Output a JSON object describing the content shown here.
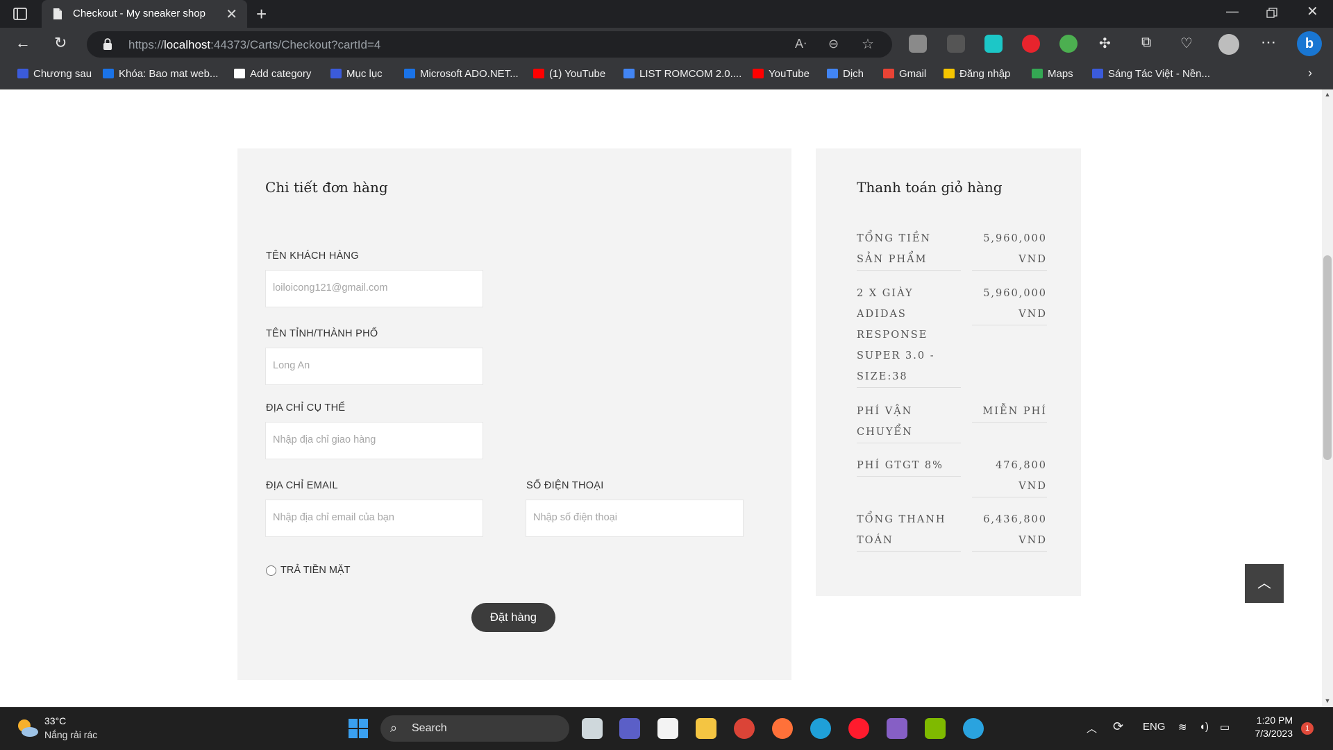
{
  "browser": {
    "tab_title": "Checkout - My sneaker shop",
    "url_prefix": "https://",
    "url_host": "localhost",
    "url_rest": ":44373/Carts/Checkout?cartId=4"
  },
  "bookmarks": [
    {
      "label": "Chương sau",
      "icon": "page-icon",
      "color": "#3b5bdb"
    },
    {
      "label": "Khóa: Bao mat web...",
      "icon": "t-icon",
      "color": "#1a73e8"
    },
    {
      "label": "Add category",
      "icon": "document-icon",
      "color": "#ffffff"
    },
    {
      "label": "Mục lục",
      "icon": "page-icon",
      "color": "#3b5bdb"
    },
    {
      "label": "Microsoft ADO.NET...",
      "icon": "t-icon",
      "color": "#1a73e8"
    },
    {
      "label": "(1) YouTube",
      "icon": "youtube-icon",
      "color": "#ff0000"
    },
    {
      "label": "LIST ROMCOM 2.0....",
      "icon": "docs-icon",
      "color": "#4285f4"
    },
    {
      "label": "YouTube",
      "icon": "youtube-icon",
      "color": "#ff0000"
    },
    {
      "label": "Dịch",
      "icon": "translate-icon",
      "color": "#4285f4"
    },
    {
      "label": "Gmail",
      "icon": "gmail-icon",
      "color": "#ea4335"
    },
    {
      "label": "Đăng nhập",
      "icon": "n-icon",
      "color": "#f6c600"
    },
    {
      "label": "Maps",
      "icon": "maps-icon",
      "color": "#34a853"
    },
    {
      "label": "Sáng Tác Việt - Nền...",
      "icon": "page-icon",
      "color": "#3b5bdb"
    }
  ],
  "checkout": {
    "title": "Chi tiết đơn hàng",
    "fields": {
      "name": {
        "label": "TÊN KHÁCH HÀNG",
        "placeholder": "loiloicong121@gmail.com"
      },
      "city": {
        "label": "TÊN TỈNH/THÀNH PHỐ",
        "placeholder": "Long An"
      },
      "address": {
        "label": "ĐỊA CHỈ CỤ THỂ",
        "placeholder": "Nhập địa chỉ giao hàng"
      },
      "email": {
        "label": "ĐỊA CHỈ EMAIL",
        "placeholder": "Nhập địa chỉ email của bạn"
      },
      "phone": {
        "label": "SỐ ĐIỆN THOẠI",
        "placeholder": "Nhập số điện thoại"
      }
    },
    "payment_option": "TRẢ TIỀN MẶT",
    "submit_label": "Đặt hàng"
  },
  "summary": {
    "title": "Thanh toán giỏ hàng",
    "rows": [
      {
        "label_lines": [
          "TỔNG TIỀN",
          "SẢN PHẨM"
        ],
        "value_lines": [
          "5,960,000",
          "VND"
        ]
      },
      {
        "label_lines": [
          "2 X GIÀY",
          "ADIDAS",
          "RESPONSE",
          "SUPER 3.0 -",
          "SIZE:38"
        ],
        "value_lines": [
          "5,960,000",
          "VND"
        ]
      },
      {
        "label_lines": [
          "PHÍ VẬN",
          "CHUYỂN"
        ],
        "value_lines": [
          "MIỄN PHÍ"
        ]
      },
      {
        "label_lines": [
          "PHÍ GTGT 8%"
        ],
        "value_lines": [
          "476,800",
          "VND"
        ]
      },
      {
        "label_lines": [
          "TỔNG THANH",
          "TOÁN"
        ],
        "value_lines": [
          "6,436,800",
          "VND"
        ]
      }
    ]
  },
  "back_to_top_icon": "chevron-up-icon",
  "taskbar": {
    "weather_temp": "33°C",
    "weather_desc": "Nắng rải rác",
    "search_label": "Search",
    "language": "ENG",
    "time": "1:20 PM",
    "date": "7/3/2023",
    "notification_count": "1"
  }
}
